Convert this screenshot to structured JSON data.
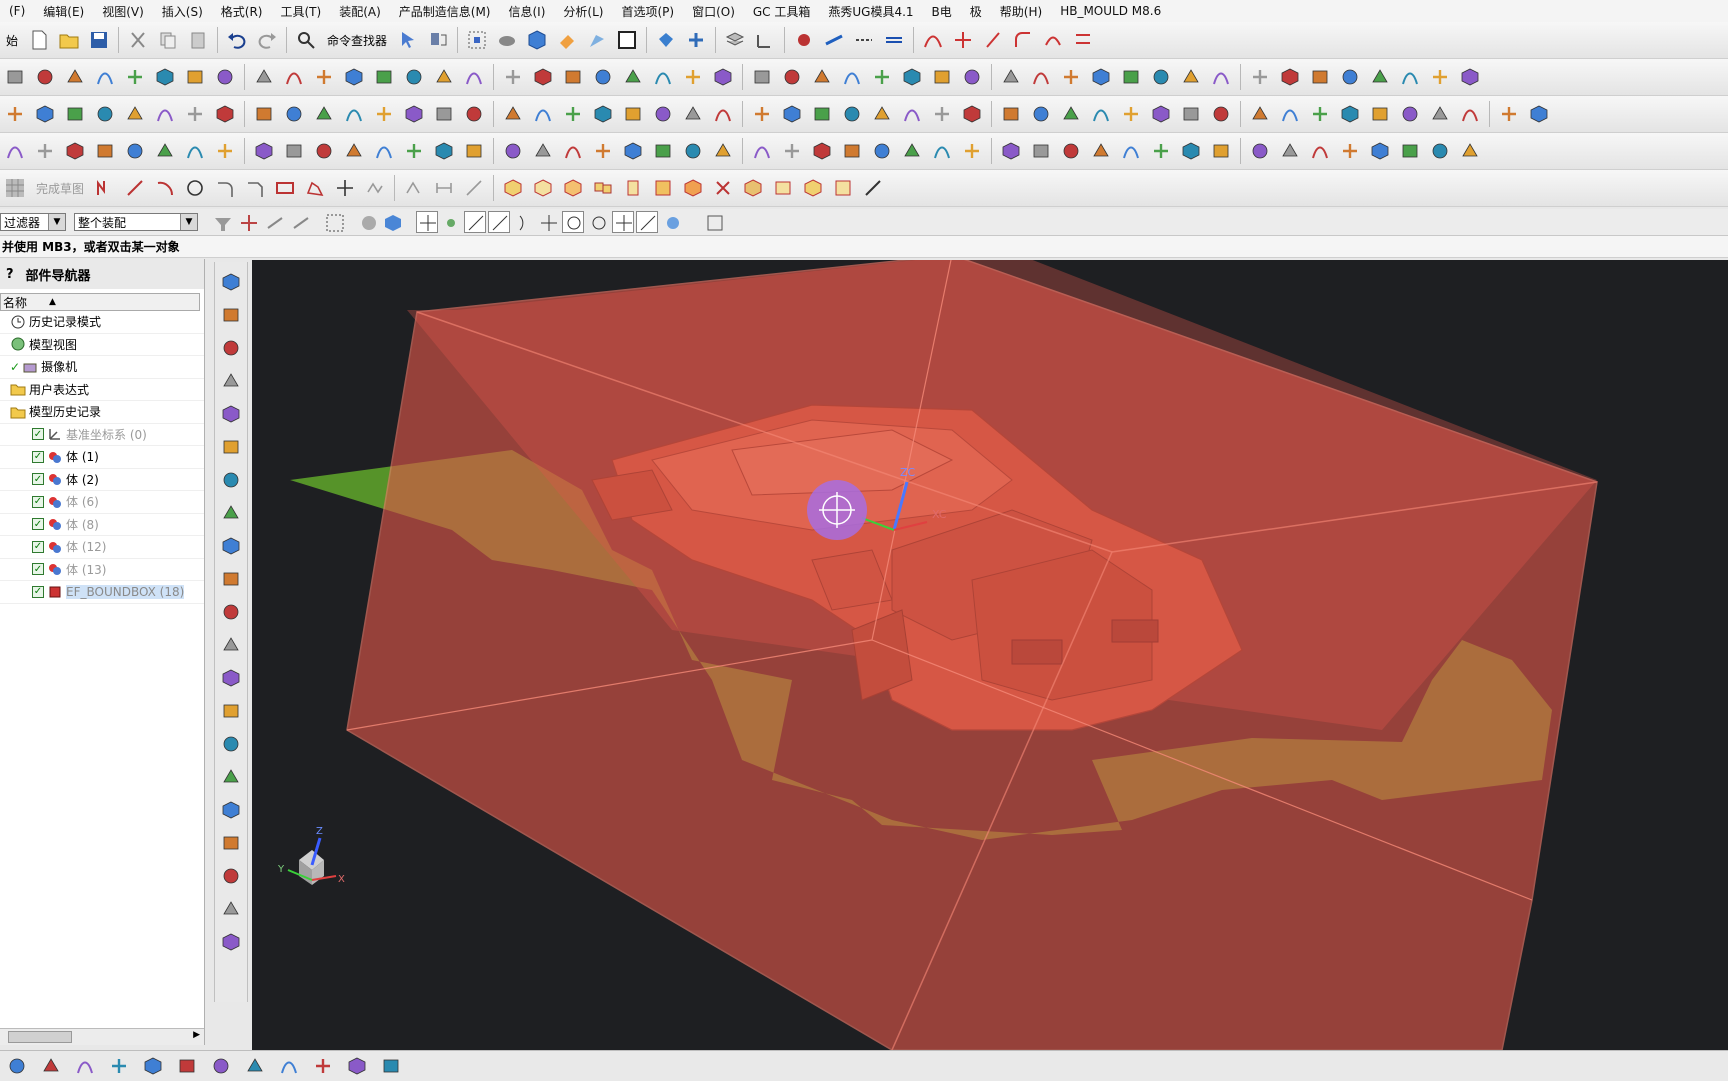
{
  "menu": [
    "(F)",
    "编辑(E)",
    "视图(V)",
    "插入(S)",
    "格式(R)",
    "工具(T)",
    "装配(A)",
    "产品制造信息(M)",
    "信息(I)",
    "分析(L)",
    "首选项(P)",
    "窗口(O)",
    "GC 工具箱",
    "燕秀UG模具4.1",
    "B电",
    "极",
    "帮助(H)",
    "HB_MOULD M8.6"
  ],
  "toolbar": {
    "start_label": "始",
    "command_finder_label": "命令查找器",
    "sketch_finish_label": "完成草图"
  },
  "filter": {
    "type_filter": "过滤器",
    "scope": "整个装配"
  },
  "status_text": "并使用 MB3，或者双击某一对象",
  "navigator": {
    "title": "部件导航器",
    "column_name": "名称",
    "items": [
      {
        "label": "历史记录模式"
      },
      {
        "label": "模型视图"
      },
      {
        "label": "摄像机"
      },
      {
        "label": "用户表达式"
      },
      {
        "label": "模型历史记录"
      },
      {
        "label": "基准坐标系 (0)"
      },
      {
        "label": "体 (1)"
      },
      {
        "label": "体 (2)"
      },
      {
        "label": "体 (6)"
      },
      {
        "label": "体 (8)"
      },
      {
        "label": "体 (12)"
      },
      {
        "label": "体 (13)"
      },
      {
        "label": "EF_BOUNDBOX (18)"
      }
    ]
  },
  "viewport": {
    "axis_labels": {
      "zc": "ZC",
      "xc": "XC",
      "x": "X",
      "y": "Y",
      "z": "Z"
    },
    "colors": {
      "background": "#1e1f22",
      "box": "#e0564a",
      "sheet": "#5a9a2a",
      "part": "#c8623f",
      "cursor": "#a86de0"
    }
  }
}
